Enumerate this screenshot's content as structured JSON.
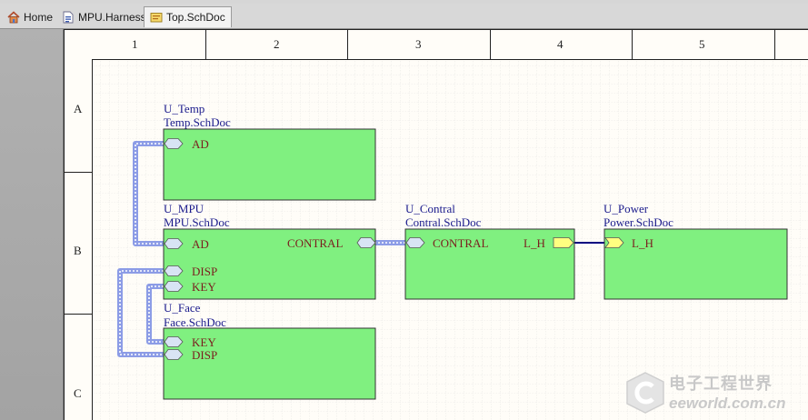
{
  "tabs": [
    {
      "label": "Home",
      "icon": "home-icon"
    },
    {
      "label": "MPU.Harness",
      "icon": "harness-file-icon"
    },
    {
      "label": "Top.SchDoc",
      "icon": "schematic-doc-icon",
      "active": true
    }
  ],
  "border": {
    "columns": [
      "1",
      "2",
      "3",
      "4",
      "5"
    ],
    "rows": [
      "A",
      "B",
      "C"
    ]
  },
  "sheet_symbols": {
    "temp": {
      "designator": "U_Temp",
      "filename": "Temp.SchDoc",
      "ports": [
        "AD"
      ]
    },
    "mpu": {
      "designator": "U_MPU",
      "filename": "MPU.SchDoc",
      "ports": [
        "AD",
        "DISP",
        "KEY",
        "CONTRAL"
      ]
    },
    "contral": {
      "designator": "U_Contral",
      "filename": "Contral.SchDoc",
      "ports": [
        "CONTRAL",
        "L_H"
      ]
    },
    "power": {
      "designator": "U_Power",
      "filename": "Power.SchDoc",
      "ports": [
        "L_H"
      ]
    },
    "face": {
      "designator": "U_Face",
      "filename": "Face.SchDoc",
      "ports": [
        "KEY",
        "DISP"
      ]
    }
  },
  "colors": {
    "sheet_fill": "#80f080",
    "signal_harness": "#8c9ce6",
    "wire": "#000080",
    "port_fill": "#d8e4f4",
    "output_port_fill": "#ffff80"
  },
  "watermark": {
    "cn": "电子工程世界",
    "en": "eeworld.com.cn"
  }
}
